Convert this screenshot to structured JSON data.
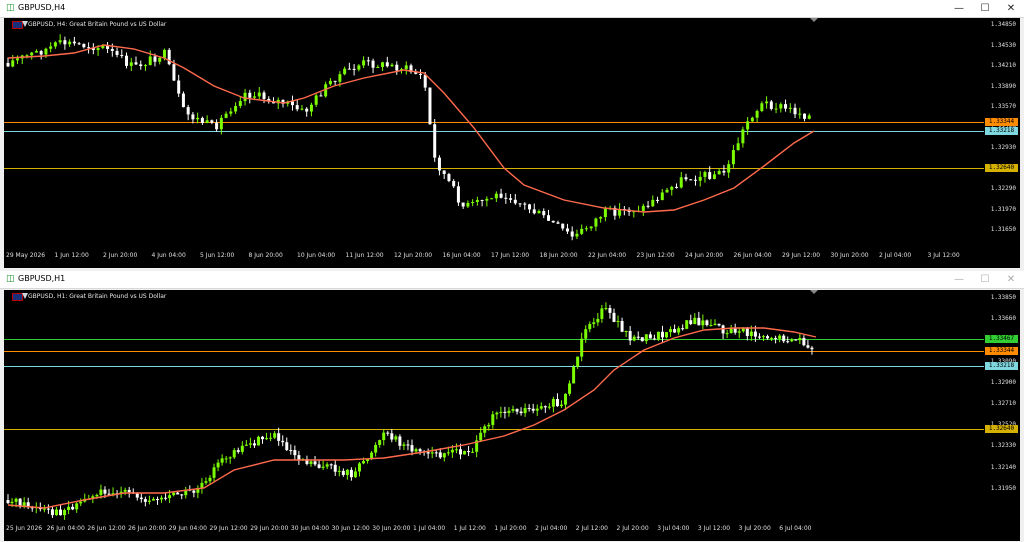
{
  "windows": [
    {
      "title": "GBPUSD,H4",
      "panel_title": "GBPUSD, H4:  Great Britain Pound vs US Dollar",
      "y_ticks": [
        "1.34850",
        "1.34530",
        "1.34210",
        "1.33890",
        "1.33570",
        "1.33250",
        "1.32930",
        "1.32610",
        "1.32290",
        "1.31970",
        "1.31650"
      ],
      "x_ticks": [
        "29 May 2026",
        "1 Jun 12:00",
        "2 Jun 20:00",
        "4 Jun 04:00",
        "5 Jun 12:00",
        "8 Jun 20:00",
        "10 Jun 04:00",
        "11 Jun 12:00",
        "12 Jun 20:00",
        "16 Jun 04:00",
        "17 Jun 12:00",
        "18 Jun 20:00",
        "22 Jun 04:00",
        "23 Jun 12:00",
        "24 Jun 20:00",
        "26 Jun 04:00",
        "29 Jun 12:00",
        "30 Jun 20:00",
        "2 Jul 04:00",
        "3 Jul 12:00"
      ],
      "price_labels": {
        "orange": "1.33344",
        "cyan": "1.33218",
        "yellow": "1.32640"
      }
    },
    {
      "title": "GBPUSD,H1",
      "panel_title": "GBPUSD, H1:  Great Britain Pound vs US Dollar",
      "y_ticks": [
        "1.33850",
        "1.33660",
        "1.33280",
        "1.33090",
        "1.32900",
        "1.32710",
        "1.32520",
        "1.32330",
        "1.32140",
        "1.31950"
      ],
      "x_ticks": [
        "25 Jun 2026",
        "26 Jun 04:00",
        "26 Jun 12:00",
        "26 Jun 20:00",
        "29 Jun 04:00",
        "29 Jun 12:00",
        "29 Jun 20:00",
        "30 Jun 04:00",
        "30 Jun 12:00",
        "30 Jun 20:00",
        "1 Jul 04:00",
        "1 Jul 12:00",
        "1 Jul 20:00",
        "2 Jul 04:00",
        "2 Jul 12:00",
        "2 Jul 20:00",
        "3 Jul 04:00",
        "3 Jul 12:00",
        "3 Jul 20:00",
        "6 Jul 04:00"
      ],
      "price_labels": {
        "green": "1.33467",
        "orange": "1.33344",
        "cyan": "1.33218",
        "yellow": "1.32640"
      }
    }
  ],
  "colors": {
    "bull": "#7CFC00",
    "bear": "#ffffff",
    "ma": "#ff6a4d",
    "orange_line": "#ff8c00",
    "cyan_line": "#7fd8e0",
    "yellow_line": "#d4b000",
    "green_line": "#32cd32"
  },
  "icons": {
    "restore": "restore-icon",
    "minimize": "minimize-icon",
    "maximize": "maximize-icon",
    "close": "close-icon"
  }
}
